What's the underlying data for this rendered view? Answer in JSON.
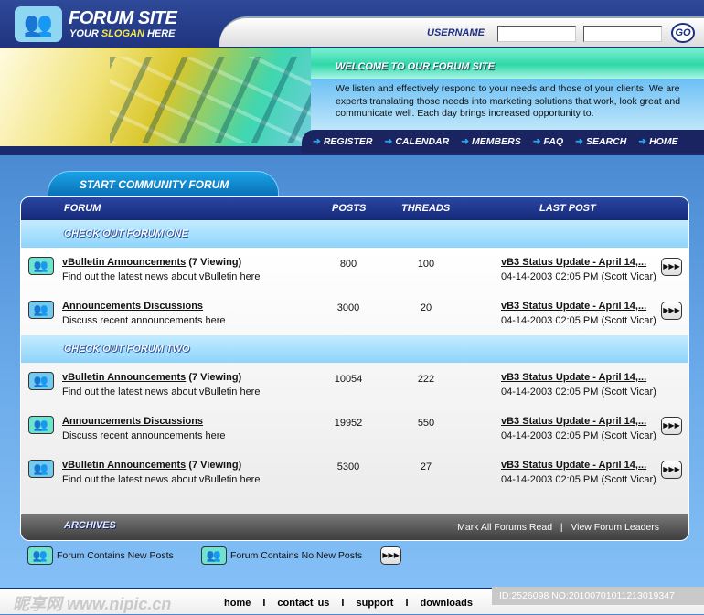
{
  "header": {
    "title": "FORUM SITE",
    "slogan_pre": "YOUR ",
    "slogan_em": "SLOGAN",
    "slogan_post": " HERE",
    "username_label": "USERNAME",
    "go_label": "GO"
  },
  "welcome": {
    "title": "WELCOME TO OUR FORUM SITE",
    "text": "We listen and effectively respond to your needs and those of your clients. We are experts translating those needs into marketing solutions that work, look great and communicate well. Each day brings increased opportunity to."
  },
  "nav": [
    "REGISTER",
    "CALENDAR",
    "MEMBERS",
    "FAQ",
    "SEARCH",
    "HOME"
  ],
  "tab": "START COMMUNITY FORUM",
  "columns": {
    "forum": "FORUM",
    "posts": "POSTS",
    "threads": "THREADS",
    "last_post": "LAST POST"
  },
  "categories": [
    {
      "title": "CHECK OUT  FORUM ONE",
      "rows": [
        {
          "name": "vBulletin Announcements",
          "viewing": " (7 Viewing)",
          "desc": "Find out the latest news about vBulletin here",
          "posts": "800",
          "threads": "100",
          "last_title": "vB3 Status Update - April 14,...",
          "last_date": "04-14-2003 02:05 PM (Scott Vicar)",
          "icon": "new",
          "arrow": true
        },
        {
          "name": "Announcements Discussions",
          "viewing": "",
          "desc": "Discuss recent announcements here",
          "posts": "3000",
          "threads": "20",
          "last_title": "vB3 Status Update - April 14,...",
          "last_date": "04-14-2003 02:05 PM (Scott Vicar)",
          "icon": "old",
          "arrow": true
        }
      ]
    },
    {
      "title": "CHECK OUT FORUM TWO",
      "rows": [
        {
          "name": "vBulletin Announcements",
          "viewing": " (7 Viewing)",
          "desc": "Find out the latest news about vBulletin here",
          "posts": "10054",
          "threads": "222",
          "last_title": "vB3 Status Update - April 14,...",
          "last_date": "04-14-2003 02:05 PM (Scott Vicar)",
          "icon": "old",
          "arrow": false
        },
        {
          "name": "Announcements Discussions",
          "viewing": "",
          "desc": "Discuss recent announcements here",
          "posts": "19952",
          "threads": "550",
          "last_title": "vB3 Status Update - April 14,...",
          "last_date": "04-14-2003 02:05 PM (Scott Vicar)",
          "icon": "new",
          "arrow": true
        },
        {
          "name": "vBulletin Announcements",
          "viewing": " (7 Viewing)",
          "desc": "Find out the latest news about vBulletin here",
          "posts": "5300",
          "threads": "27",
          "last_title": "vB3 Status Update - April 14,...",
          "last_date": "04-14-2003 02:05 PM (Scott Vicar)",
          "icon": "old",
          "arrow": true
        }
      ]
    }
  ],
  "archives": {
    "label": "ARCHIVES",
    "mark_read": "Mark All Forums Read",
    "sep": "|",
    "leaders": "View Forum Leaders"
  },
  "legend": {
    "new": "Forum Contains New Posts",
    "no_new": "Forum Contains No New Posts"
  },
  "footer": {
    "links": [
      "home",
      "contact us",
      "support",
      "downloads"
    ],
    "watermark": "昵享网 www.nipic.cn",
    "watermark_id": "ID:2526098 NO:20100701011213019347"
  },
  "icons": {
    "forum": "two-people-icon",
    "arrow": "triple-arrow-icon",
    "nav": "arrow-right-icon"
  }
}
